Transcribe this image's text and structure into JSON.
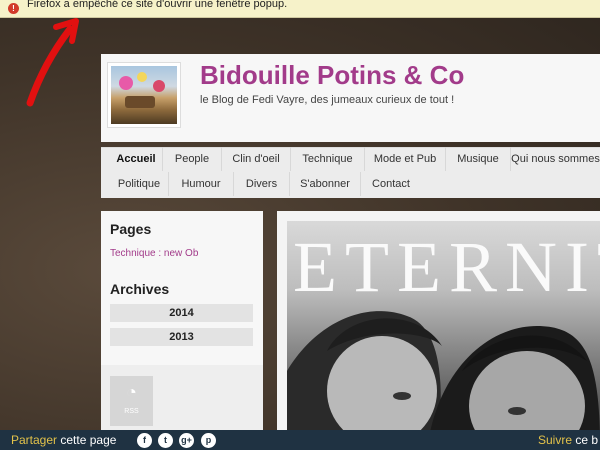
{
  "popup": {
    "message": "Firefox a empêché ce site d'ouvrir une fenêtre popup."
  },
  "site": {
    "title": "Bidouille Potins & Co",
    "tagline": "le Blog de Fedi Vayre, des jumeaux curieux de tout !"
  },
  "nav": {
    "items": [
      {
        "label": "Accueil",
        "active": true
      },
      {
        "label": "People"
      },
      {
        "label": "Clin d'oeil"
      },
      {
        "label": "Technique"
      },
      {
        "label": "Mode et Pub"
      },
      {
        "label": "Musique"
      },
      {
        "label": "Qui nous sommes"
      },
      {
        "label": "Politique"
      },
      {
        "label": "Humour"
      },
      {
        "label": "Divers"
      },
      {
        "label": "S'abonner"
      },
      {
        "label": "Contact"
      }
    ]
  },
  "sidebar": {
    "pages_heading": "Pages",
    "pages_link": "Technique : new Ob",
    "archives_heading": "Archives",
    "archives": [
      "2014",
      "2013"
    ],
    "rss_label": "RSS"
  },
  "main": {
    "photo_title": "ETERNITY"
  },
  "footer": {
    "share_word": "Partager",
    "share_rest": "cette page",
    "social_icons": [
      "facebook-icon",
      "twitter-icon",
      "googleplus-icon",
      "pinterest-icon"
    ],
    "social_glyphs": [
      "f",
      "t",
      "g+",
      "p"
    ],
    "follow_word": "Suivre",
    "follow_rest": "ce b"
  },
  "colors": {
    "accent": "#a23b8a",
    "footer_bg": "#1f3242",
    "footer_accent": "#e3c24a"
  }
}
